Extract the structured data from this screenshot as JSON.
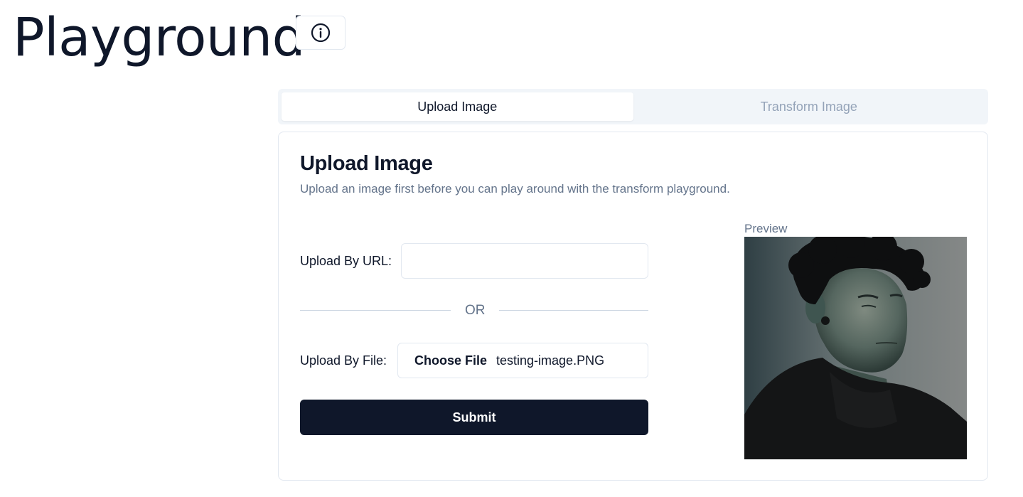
{
  "page": {
    "title": "Playground"
  },
  "header": {
    "info_icon": "info-circle-icon"
  },
  "tabs": [
    {
      "label": "Upload Image",
      "active": true
    },
    {
      "label": "Transform Image",
      "active": false
    }
  ],
  "card": {
    "title": "Upload Image",
    "description": "Upload an image first before you can play around with the transform playground.",
    "url_label": "Upload By URL:",
    "url_value": "",
    "url_placeholder": "",
    "divider_text": "OR",
    "file_label": "Upload By File:",
    "choose_file_label": "Choose File",
    "file_name": "testing-image.PNG",
    "submit_label": "Submit",
    "preview_label": "Preview"
  },
  "colors": {
    "primary": "#0f172a",
    "muted": "#64748b",
    "border": "#e2e8f0",
    "tabs_bg": "#f1f5f9"
  }
}
